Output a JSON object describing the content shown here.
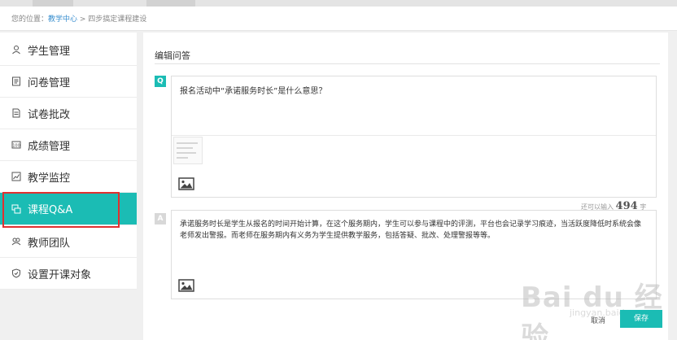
{
  "breadcrumb": {
    "prefix": "您的位置：",
    "link": "教学中心",
    "separator": " > ",
    "current": "四步搞定课程建设"
  },
  "sidebar": {
    "items": [
      {
        "label": "学生管理",
        "icon": "user-icon"
      },
      {
        "label": "问卷管理",
        "icon": "survey-icon"
      },
      {
        "label": "试卷批改",
        "icon": "paper-icon"
      },
      {
        "label": "成绩管理",
        "icon": "grade-icon"
      },
      {
        "label": "教学监控",
        "icon": "chart-icon"
      },
      {
        "label": "课程Q&A",
        "icon": "qa-icon",
        "active": true
      },
      {
        "label": "教师团队",
        "icon": "team-icon"
      },
      {
        "label": "设置开课对象",
        "icon": "shield-icon"
      }
    ]
  },
  "editor": {
    "title": "编辑问答",
    "q_badge": "Q",
    "a_badge": "A",
    "question": "报名活动中“承诺服务时长”是什么意思？",
    "counter_prefix": "还可以输入",
    "counter_value": "494",
    "counter_suffix": "字",
    "answer": "承诺服务时长是学生从报名的时间开始计算，在这个服务期内，学生可以参与课程中的评测，平台也会记录学习痕迹，当活跃度降低时系统会像老师发出警报。而老师在服务期内有义务为学生提供教学服务，包括答疑、批改、处理警报等等。"
  },
  "actions": {
    "cancel": "取消",
    "save": "保存"
  },
  "watermark": {
    "logo": "Bai du 经验",
    "url": "jingyan.baidu.com"
  },
  "colors": {
    "accent": "#1bbcb4",
    "highlight": "#e03030"
  }
}
